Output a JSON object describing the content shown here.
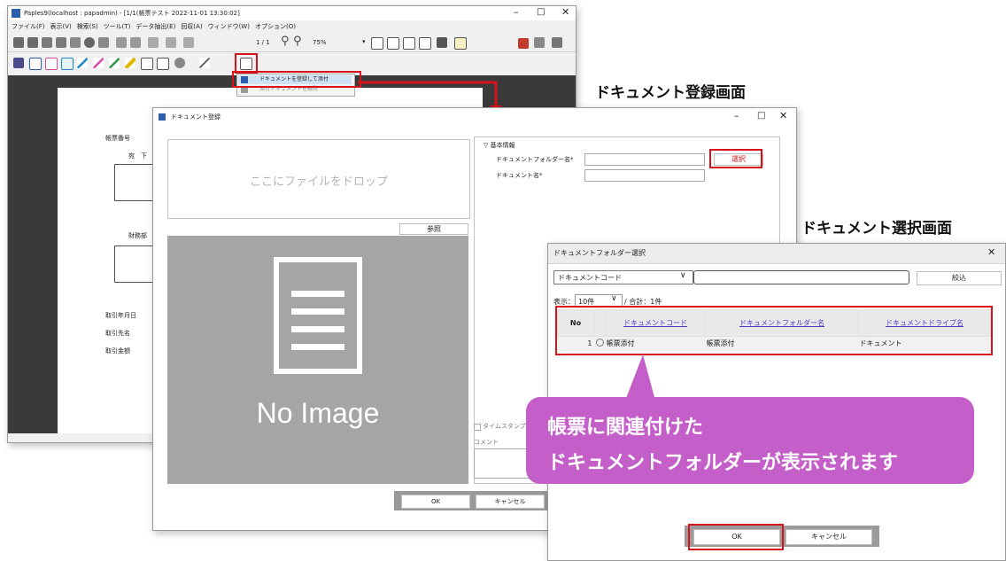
{
  "colors": {
    "accent_red": "#d8121a",
    "callout": "#c45ec8",
    "link": "#4a3bcc",
    "doc_dark": "#3a3a3a"
  },
  "main_window": {
    "title": "Paples9(localhost : papadmin) - [1/1(帳票テスト 2022-11-01 13:30:02]",
    "menu": [
      "ファイル(F)",
      "表示(V)",
      "検索(S)",
      "ツール(T)",
      "データ抽出(E)",
      "回収(A)",
      "ウィンドウ(W)",
      "オプション(O)"
    ],
    "page_indicator": "1 / 1",
    "zoom": "75%",
    "context_menu": [
      "ドキュメントを登録して添付",
      "添付ドキュメントを解除"
    ],
    "form_labels": [
      "帳票番号",
      "宛　下",
      "財務部",
      "取引年月日",
      "取引先名",
      "取引金額"
    ]
  },
  "headings": {
    "register_screen": "ドキュメント登録画面",
    "select_screen": "ドキュメント選択画面"
  },
  "register_dialog": {
    "title": "ドキュメント登録",
    "drop_text": "ここにファイルをドロップ",
    "browse_button": "参照",
    "no_image": "No Image",
    "section": "▽ 基本情報",
    "folder_label": "ドキュメントフォルダー名*",
    "name_label": "ドキュメント名*",
    "select_button": "選択",
    "timestamp_label": "タイムスタンプ付与",
    "comment_label": "コメント",
    "ok": "OK",
    "cancel": "キャンセル"
  },
  "select_dialog": {
    "title": "ドキュメントフォルダー選択",
    "search_field": "ドキュメントコード",
    "filter_button": "絞込",
    "display_label": "表示：",
    "page_size": "10件",
    "total": "/ 合計：1件",
    "columns": [
      "No",
      "ドキュメントコード",
      "ドキュメントフォルダー名",
      "ドキュメントドライブ名"
    ],
    "rows": [
      {
        "no": "1",
        "code": "帳票添付",
        "folder": "帳票添付",
        "drive": "ドキュメント"
      }
    ],
    "ok": "OK",
    "cancel": "キャンセル"
  },
  "callout": {
    "line1": "帳票に関連付けた",
    "line2": "ドキュメントフォルダーが表示されます"
  }
}
